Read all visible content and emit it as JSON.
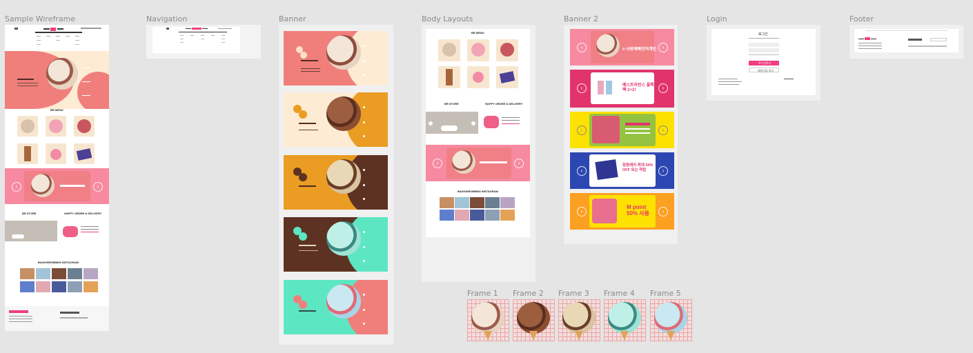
{
  "frame_labels": {
    "sample": "Sample Wireframe",
    "navigation": "Navigation",
    "banner": "Banner",
    "body_layouts": "Body Layouts",
    "banner2": "Banner 2",
    "login": "Login",
    "footer": "Footer",
    "frame1": "Frame 1",
    "frame2": "Frame 2",
    "frame3": "Frame 3",
    "frame4": "Frame 4",
    "frame5": "Frame 5"
  },
  "section_titles": {
    "br_menu": "BR MENU",
    "br_store": "BR STORE",
    "happy_order": "HAPPY ORDER & DELIVERY",
    "instagram_sample": "BASKINROBBINS INSTAGRAM",
    "instagram_body": "BASKINROBBINS INSTAGRAM"
  },
  "banner2_texts": {
    "b1_headline": "# 사랑에빠진외계인",
    "b2_headline": "베스트라빈스 플록팩 2+2!",
    "b4_headline": "장원래리 최대 50% OFF 또는 적립",
    "b5_headline": "M point 50% 사용"
  },
  "login": {
    "title": "로그인",
    "login_button": "로그인하기",
    "signup_button": "회원가입 하기"
  },
  "colors": {
    "canvas": "#e5e5e5",
    "coral": "#f07f7c",
    "cream": "#fdebd3",
    "orange": "#ea9c23",
    "brown": "#5d3222",
    "mint": "#5de6c2",
    "pink": "#f78aa0",
    "magenta": "#e2346c",
    "yellow": "#fde100",
    "blue": "#2d47b2",
    "amber": "#fca021",
    "brand_pink": "#ef3e83"
  }
}
